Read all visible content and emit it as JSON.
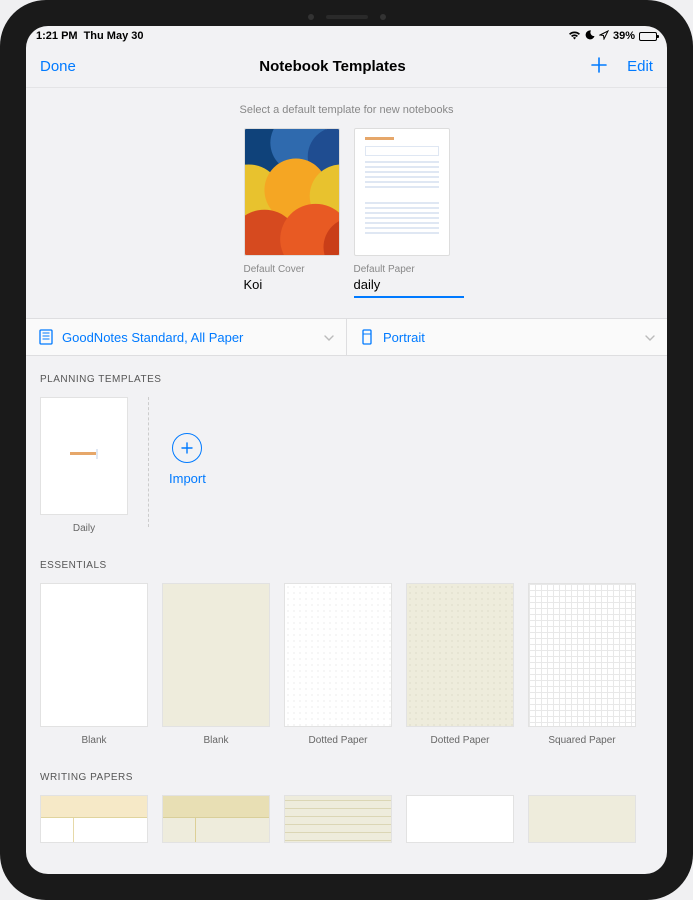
{
  "status": {
    "time": "1:21 PM",
    "date": "Thu May 30",
    "battery_pct": "39%"
  },
  "nav": {
    "done": "Done",
    "title": "Notebook Templates",
    "edit": "Edit"
  },
  "subtitle": "Select a default template for new notebooks",
  "defaults": {
    "cover": {
      "label": "Default Cover",
      "value": "Koi"
    },
    "paper": {
      "label": "Default Paper",
      "value": "daily"
    }
  },
  "filters": {
    "standard": "GoodNotes Standard, All Paper",
    "orientation": "Portrait"
  },
  "sections": {
    "planning": {
      "title": "Planning Templates",
      "items": [
        "Daily"
      ],
      "import": "Import"
    },
    "essentials": {
      "title": "Essentials",
      "items": [
        "Blank",
        "Blank",
        "Dotted Paper",
        "Dotted Paper",
        "Squared Paper"
      ]
    },
    "writing": {
      "title": "Writing Papers"
    }
  }
}
